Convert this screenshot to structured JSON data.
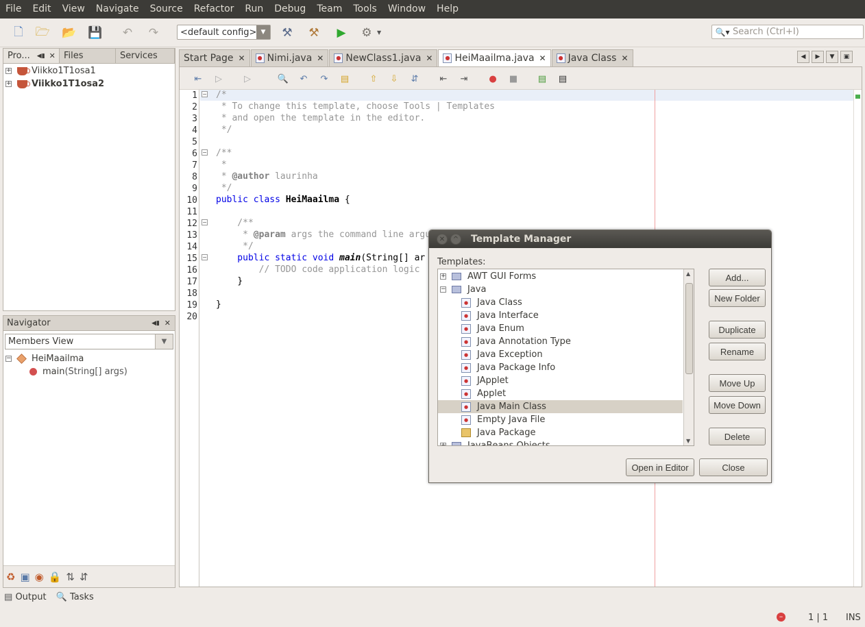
{
  "menu": [
    "File",
    "Edit",
    "View",
    "Navigate",
    "Source",
    "Refactor",
    "Run",
    "Debug",
    "Team",
    "Tools",
    "Window",
    "Help"
  ],
  "toolbar": {
    "config": "<default config>",
    "search_placeholder": "Search (Ctrl+I)"
  },
  "projects_panel": {
    "tabs": [
      "Pro...",
      "Files",
      "Services"
    ],
    "items": [
      "Viikko1T1osa1",
      "Viikko1T1osa2"
    ]
  },
  "navigator": {
    "title": "Navigator",
    "view": "Members View",
    "class_name": "HeiMaailma",
    "member_name": "main",
    "member_params": "(String[] args)"
  },
  "editor": {
    "tabs": [
      "Start Page",
      "Nimi.java",
      "NewClass1.java",
      "HeiMaailma.java",
      "Java Class"
    ],
    "active_tab": "HeiMaailma.java",
    "line_numbers": [
      "1",
      "2",
      "3",
      "4",
      "5",
      "6",
      "7",
      "8",
      "9",
      "10",
      "11",
      "12",
      "13",
      "14",
      "15",
      "16",
      "17",
      "18",
      "19",
      "20"
    ],
    "code": {
      "l1": "/*",
      "l2": " * To change this template, choose Tools | Templates",
      "l3": " * and open the template in the editor.",
      "l4": " */",
      "l6": "/**",
      "l7": " *",
      "l8_tag": "@author",
      "l8_rest": " laurinha",
      "l9": " */",
      "l10_kw": "public class ",
      "l10_name": "HeiMaailma",
      "l10_rest": " {",
      "l12": "    /**",
      "l13_pre": "     * ",
      "l13_tag": "@param",
      "l13_rest": " args the command line argu",
      "l14": "     */",
      "l15_kw": "    public static void ",
      "l15_name": "main",
      "l15_rest": "(String[] ar",
      "l16": "        // TODO code application logic",
      "l17": "    }",
      "l19": "}"
    }
  },
  "bottom": {
    "output": "Output",
    "tasks": "Tasks"
  },
  "status": {
    "position": "1 | 1",
    "mode": "INS"
  },
  "dialog": {
    "title": "Template Manager",
    "templates_label": "Templates:",
    "tree": [
      {
        "label": "AWT GUI Forms",
        "kind": "folder",
        "level": 0,
        "expander": "+"
      },
      {
        "label": "Java",
        "kind": "folder-open",
        "level": 0,
        "expander": "−"
      },
      {
        "label": "Java Class",
        "kind": "file",
        "level": 1
      },
      {
        "label": "Java Interface",
        "kind": "file",
        "level": 1
      },
      {
        "label": "Java Enum",
        "kind": "file",
        "level": 1
      },
      {
        "label": "Java Annotation Type",
        "kind": "file",
        "level": 1
      },
      {
        "label": "Java Exception",
        "kind": "file",
        "level": 1
      },
      {
        "label": "Java Package Info",
        "kind": "file",
        "level": 1
      },
      {
        "label": "JApplet",
        "kind": "file",
        "level": 1
      },
      {
        "label": "Applet",
        "kind": "file",
        "level": 1
      },
      {
        "label": "Java Main Class",
        "kind": "file",
        "level": 1,
        "selected": true
      },
      {
        "label": "Empty Java File",
        "kind": "file",
        "level": 1
      },
      {
        "label": "Java Package",
        "kind": "package",
        "level": 1
      },
      {
        "label": "JavaBeans Objects",
        "kind": "folder",
        "level": 0,
        "expander": "+"
      }
    ],
    "buttons": {
      "add": "Add...",
      "new_folder": "New Folder",
      "duplicate": "Duplicate",
      "rename": "Rename",
      "move_up": "Move Up",
      "move_down": "Move Down",
      "delete": "Delete",
      "open_in_editor": "Open in Editor",
      "close": "Close"
    }
  }
}
